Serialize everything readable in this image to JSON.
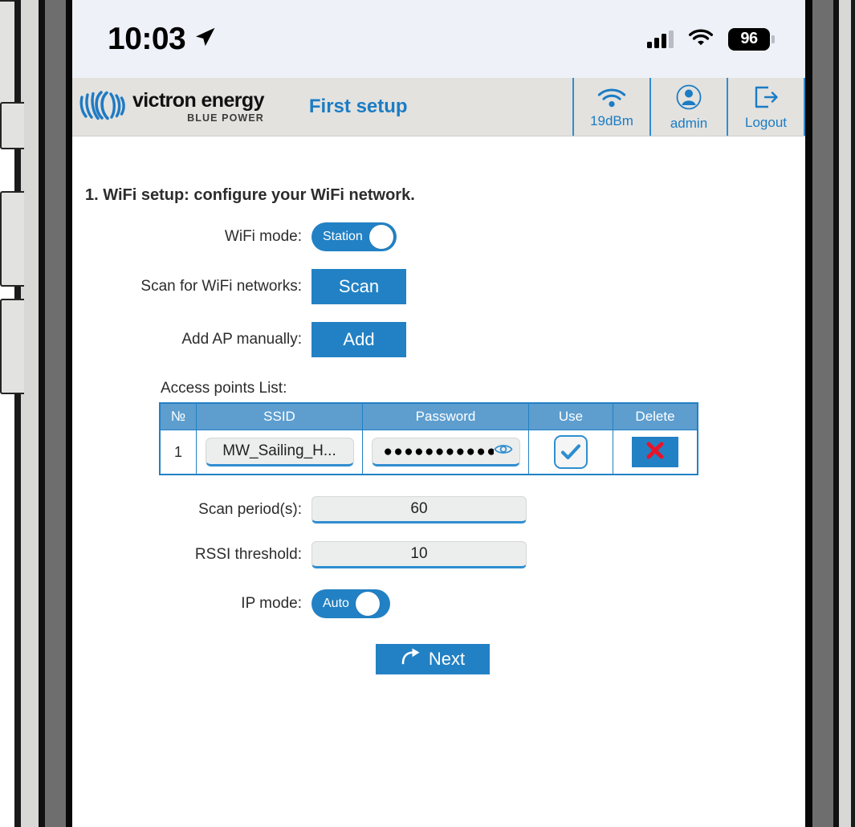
{
  "status_bar": {
    "time": "10:03",
    "location_icon": "location-arrow-icon",
    "cellular_icon": "cellular-bars-icon",
    "wifi_icon": "wifi-icon",
    "battery_level": "96"
  },
  "app_header": {
    "logo_main": "victron energy",
    "logo_sub": "BLUE POWER",
    "page_title": "First setup",
    "actions": [
      {
        "icon": "wifi-signal-icon",
        "label": "19dBm"
      },
      {
        "icon": "user-icon",
        "label": "admin"
      },
      {
        "icon": "logout-icon",
        "label": "Logout"
      }
    ]
  },
  "form": {
    "step_title": "1. WiFi setup: configure your WiFi network.",
    "wifi_mode": {
      "label": "WiFi mode:",
      "value": "Station"
    },
    "scan": {
      "label": "Scan for WiFi networks:",
      "button": "Scan"
    },
    "add_ap": {
      "label": "Add AP manually:",
      "button": "Add"
    },
    "ap_list": {
      "caption": "Access points List:",
      "columns": [
        "№",
        "SSID",
        "Password",
        "Use",
        "Delete"
      ],
      "rows": [
        {
          "no": "1",
          "ssid": "MW_Sailing_H...",
          "password": "●●●●●●●●●●●...",
          "use_checked": "true",
          "delete_icon": "red-x-icon"
        }
      ]
    },
    "scan_period": {
      "label": "Scan period(s):",
      "value": "60"
    },
    "rssi_threshold": {
      "label": "RSSI threshold:",
      "value": "10"
    },
    "ip_mode": {
      "label": "IP mode:",
      "value": "Auto"
    },
    "next_button": {
      "label": "Next",
      "icon": "forward-arrow-icon"
    }
  },
  "colors": {
    "accent_blue": "#2281c4",
    "header_blue": "#5d9ecf",
    "link_blue": "#1b7cc4",
    "header_bg": "#e3e2df",
    "status_bg": "#eef1f8",
    "danger_red": "#e8142a"
  }
}
